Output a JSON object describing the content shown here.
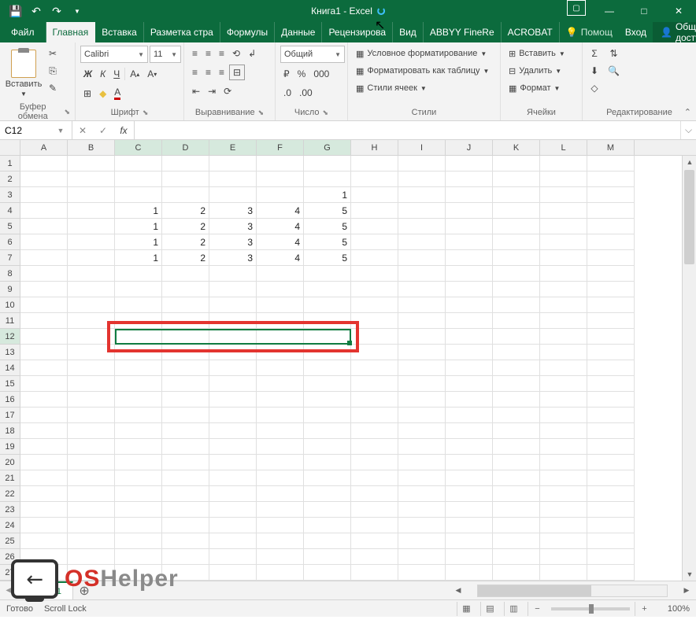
{
  "title": "Книга1 - Excel",
  "qat": {
    "save": "💾",
    "undo": "↶",
    "redo": "↷"
  },
  "win": {
    "min": "—",
    "max": "□",
    "close": "✕",
    "opts": "▢"
  },
  "tabs": {
    "file": "Файл",
    "items": [
      "Главная",
      "Вставка",
      "Разметка стра",
      "Формулы",
      "Данные",
      "Рецензирова",
      "Вид",
      "ABBYY FineRe",
      "ACROBAT"
    ],
    "help_icon": "💡",
    "help": "Помощ",
    "login": "Вход",
    "share_icon": "👤",
    "share": "Общий доступ"
  },
  "ribbon": {
    "clipboard": {
      "paste": "Вставить",
      "label": "Буфер обмена",
      "cut": "✂",
      "copy": "⎘",
      "painter": "✎"
    },
    "font": {
      "name": "Calibri",
      "size": "11",
      "bold": "Ж",
      "italic": "К",
      "underline": "Ч",
      "border": "⊞",
      "fill": "◆",
      "color": "A",
      "grow": "A",
      "shrink": "A",
      "label": "Шрифт"
    },
    "align": {
      "label": "Выравнивание",
      "wrap": "↲",
      "merge": "⊟"
    },
    "number": {
      "format": "Общий",
      "currency": "%",
      "percent": "%",
      "comma": "000",
      "inc": ".0",
      "dec": ".00",
      "label": "Число"
    },
    "styles": {
      "cond": "Условное форматирование",
      "table": "Форматировать как таблицу",
      "cell": "Стили ячеек",
      "label": "Стили"
    },
    "cells": {
      "insert": "Вставить",
      "delete": "Удалить",
      "format": "Формат",
      "label": "Ячейки"
    },
    "editing": {
      "sum": "Σ",
      "fill": "⬇",
      "clear": "◇",
      "sort": "⇅",
      "find": "🔍",
      "label": "Редактирование"
    }
  },
  "namebox": "C12",
  "fx": {
    "cancel": "✕",
    "enter": "✓",
    "fx": "fx"
  },
  "columns": [
    "A",
    "B",
    "C",
    "D",
    "E",
    "F",
    "G",
    "H",
    "I",
    "J",
    "K",
    "L",
    "M"
  ],
  "rows": 27,
  "cells": {
    "G3": "1",
    "C4": "1",
    "D4": "2",
    "E4": "3",
    "F4": "4",
    "G4": "5",
    "C5": "1",
    "D5": "2",
    "E5": "3",
    "F5": "4",
    "G5": "5",
    "C6": "1",
    "D6": "2",
    "E6": "3",
    "F6": "4",
    "G6": "5",
    "C7": "1",
    "D7": "2",
    "E7": "3",
    "F7": "4",
    "G7": "5"
  },
  "selection": {
    "cols": [
      "C",
      "D",
      "E",
      "F",
      "G"
    ],
    "row": 12
  },
  "sheet": {
    "name": "Лист1",
    "add": "⊕"
  },
  "status": {
    "ready": "Готово",
    "scroll": "Scroll Lock",
    "zoom": "100%"
  },
  "watermark": {
    "os": "OS",
    "helper": "Helper"
  }
}
